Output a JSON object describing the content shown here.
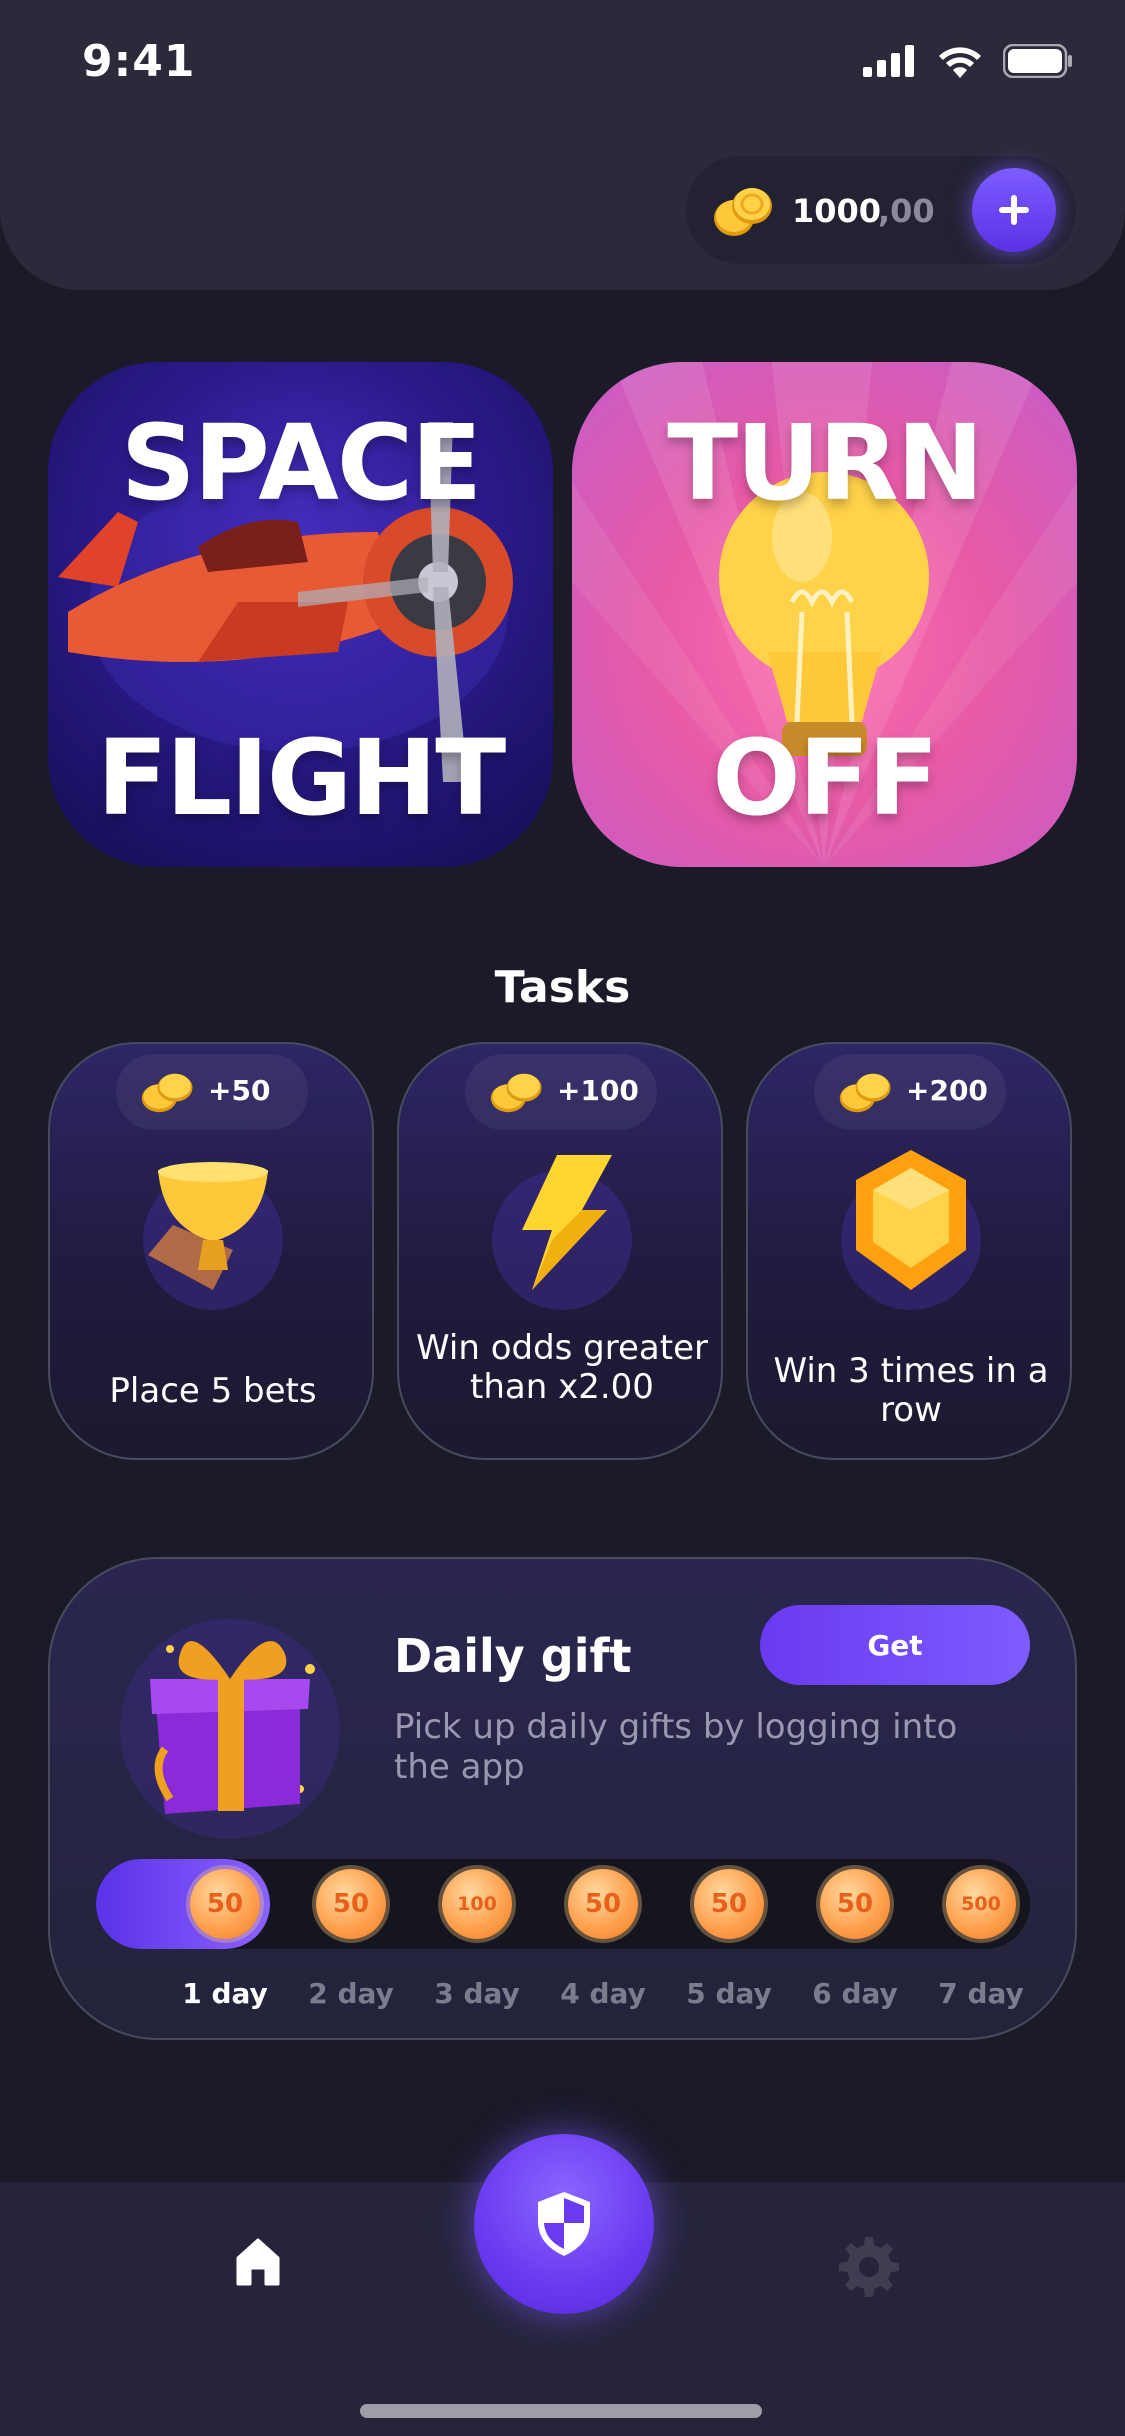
{
  "status_bar": {
    "time": "9:41"
  },
  "balance": {
    "amount": "1000",
    "fraction": ",00"
  },
  "games": [
    {
      "top_word": "SPACE",
      "bottom_word": "FLIGHT"
    },
    {
      "top_word": "TURN",
      "bottom_word": "OFF"
    }
  ],
  "tasks": {
    "title": "Tasks",
    "items": [
      {
        "reward": "+50",
        "label": "Place 5 bets",
        "icon": "trophy-icon"
      },
      {
        "reward": "+100",
        "label": "Win odds greater than x2.00",
        "icon": "lightning-icon"
      },
      {
        "reward": "+200",
        "label": "Win 3 times in a row",
        "icon": "gem-icon"
      }
    ]
  },
  "daily_gift": {
    "title": "Daily gift",
    "description": "Pick up daily gifts by logging into the app",
    "button": "Get",
    "days": [
      {
        "amount": "50",
        "label": "1 day"
      },
      {
        "amount": "50",
        "label": "2 day"
      },
      {
        "amount": "100",
        "label": "3 day"
      },
      {
        "amount": "50",
        "label": "4 day"
      },
      {
        "amount": "50",
        "label": "5 day"
      },
      {
        "amount": "50",
        "label": "6 day"
      },
      {
        "amount": "500",
        "label": "7 day"
      }
    ]
  },
  "colors": {
    "accent": "#6a3af0",
    "background": "#1a1a28",
    "coin": "#ffa250"
  },
  "tabbar": {
    "tabs": [
      "home-icon",
      "shield-icon",
      "gear-icon"
    ]
  }
}
